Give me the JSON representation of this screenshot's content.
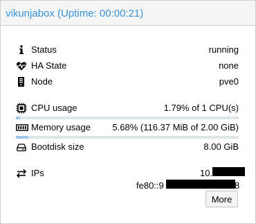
{
  "panel": {
    "title": "vikunjabox (Uptime: 00:00:21)"
  },
  "status_rows": [
    {
      "label": "Status",
      "value": "running",
      "icon": "info-icon"
    },
    {
      "label": "HA State",
      "value": "none",
      "icon": "heartbeat-icon"
    },
    {
      "label": "Node",
      "value": "pve0",
      "icon": "server-icon"
    }
  ],
  "usage_rows": [
    {
      "label": "CPU usage",
      "value": "1.79% of 1 CPU(s)",
      "icon": "cpu-icon",
      "fraction": 0.0179
    },
    {
      "label": "Memory usage",
      "value": "5.68% (116.37 MiB of 2.00 GiB)",
      "icon": "memory-icon",
      "fraction": 0.0568
    },
    {
      "label": "Bootdisk size",
      "value": "8.00 GiB",
      "icon": "hdd-icon"
    }
  ],
  "ips": {
    "label": "IPs",
    "icon": "exchange-icon",
    "ipv4_visible": "10.",
    "ipv6_prefix": "fe80::9",
    "ipv6_suffix": "8"
  },
  "buttons": {
    "more": "More"
  },
  "colors": {
    "title": "#3892d4",
    "bar_track": "#dde4ea",
    "bar_fill": "#9fc7e6"
  }
}
